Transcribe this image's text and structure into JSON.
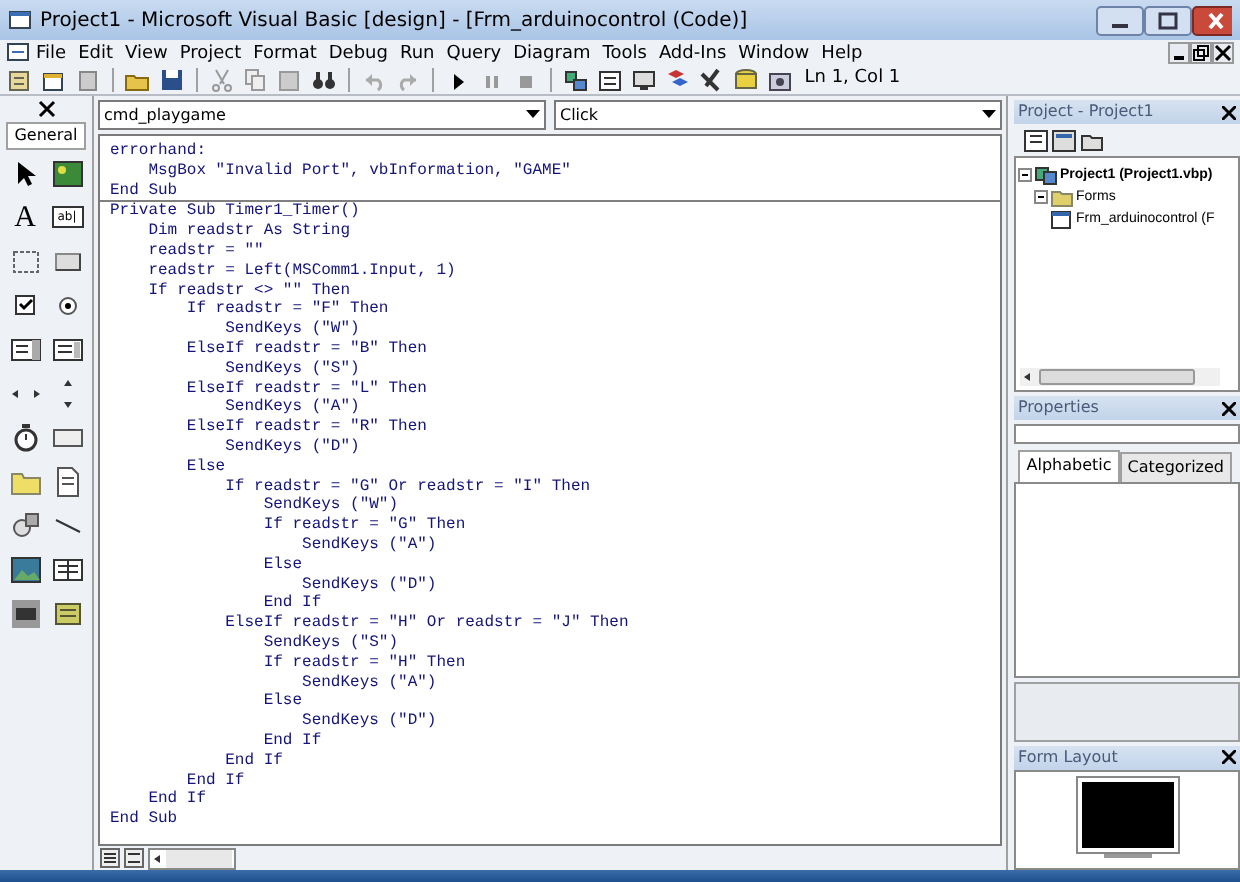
{
  "window": {
    "title": "Project1 - Microsoft Visual Basic [design] - [Frm_arduinocontrol (Code)]"
  },
  "menu": [
    "File",
    "Edit",
    "View",
    "Project",
    "Format",
    "Debug",
    "Run",
    "Query",
    "Diagram",
    "Tools",
    "Add-Ins",
    "Window",
    "Help"
  ],
  "toolbar": {
    "position": "Ln 1, Col 1"
  },
  "toolbox": {
    "title": "General",
    "label_tool_glyph": "A",
    "textbox_tool_glyph": "ab|"
  },
  "code_window": {
    "object": "cmd_playgame",
    "procedure": "Click",
    "procedures": [
      [
        "errorhand:",
        "    MsgBox \"Invalid Port\", vbInformation, \"GAME\"",
        "End Sub"
      ],
      [
        "Private Sub Timer1_Timer()",
        "    Dim readstr As String",
        "    readstr = \"\"",
        "    readstr = Left(MSComm1.Input, 1)",
        "    If readstr <> \"\" Then",
        "        If readstr = \"F\" Then",
        "            SendKeys (\"W\")",
        "        ElseIf readstr = \"B\" Then",
        "            SendKeys (\"S\")",
        "        ElseIf readstr = \"L\" Then",
        "            SendKeys (\"A\")",
        "        ElseIf readstr = \"R\" Then",
        "            SendKeys (\"D\")",
        "        Else",
        "            If readstr = \"G\" Or readstr = \"I\" Then",
        "                SendKeys (\"W\")",
        "                If readstr = \"G\" Then",
        "                    SendKeys (\"A\")",
        "                Else",
        "                    SendKeys (\"D\")",
        "                End If",
        "            ElseIf readstr = \"H\" Or readstr = \"J\" Then",
        "                SendKeys (\"S\")",
        "                If readstr = \"H\" Then",
        "                    SendKeys (\"A\")",
        "                Else",
        "                    SendKeys (\"D\")",
        "                End If",
        "            End If",
        "        End If",
        "    End If",
        "End Sub"
      ]
    ]
  },
  "project_explorer": {
    "title": "Project - Project1",
    "tree": [
      {
        "label": "Project1 (Project1.vbp)",
        "kind": "project",
        "expanded": true,
        "children": [
          {
            "label": "Forms",
            "kind": "folder",
            "expanded": true,
            "children": [
              {
                "label": "Frm_arduinocontrol (F",
                "kind": "form"
              }
            ]
          }
        ]
      }
    ]
  },
  "properties": {
    "title": "Properties",
    "tabs": [
      {
        "label": "Alphabetic",
        "selected": true
      },
      {
        "label": "Categorized",
        "selected": false
      }
    ]
  },
  "form_layout": {
    "title": "Form Layout"
  }
}
